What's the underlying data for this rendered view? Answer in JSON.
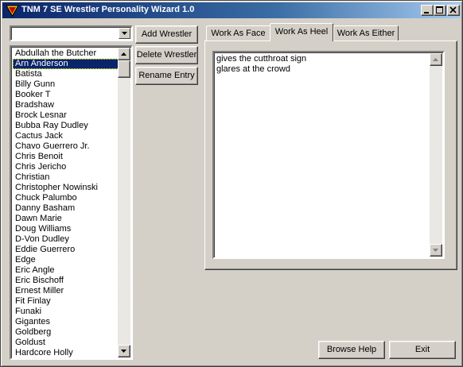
{
  "window": {
    "title": "TNM 7 SE Wrestler Personality Wizard 1.0"
  },
  "combo": {
    "value": ""
  },
  "wrestlers": [
    "Abdullah the Butcher",
    "Arn Anderson",
    "Batista",
    "Billy Gunn",
    "Booker T",
    "Bradshaw",
    "Brock Lesnar",
    "Bubba Ray Dudley",
    "Cactus Jack",
    "Chavo Guerrero Jr.",
    "Chris Benoit",
    "Chris Jericho",
    "Christian",
    "Christopher Nowinski",
    "Chuck Palumbo",
    "Danny Basham",
    "Dawn Marie",
    "Doug Williams",
    "D-Von Dudley",
    "Eddie Guerrero",
    "Edge",
    "Eric Angle",
    "Eric Bischoff",
    "Ernest Miller",
    "Fit Finlay",
    "Funaki",
    "Gigantes",
    "Goldberg",
    "Goldust",
    "Hardcore Holly"
  ],
  "selected_wrestler": "Arn Anderson",
  "buttons": {
    "add": "Add Wrestler",
    "delete": "Delete Wrestler",
    "rename": "Rename Entry",
    "browse_help": "Browse Help",
    "exit": "Exit"
  },
  "tabs": [
    {
      "label": "Work As Face",
      "active": false
    },
    {
      "label": "Work As Heel",
      "active": true
    },
    {
      "label": "Work As Either",
      "active": false
    }
  ],
  "memo_lines": [
    "gives the cutthroat sign",
    "glares at the crowd"
  ],
  "colors": {
    "face": "#d4d0c8",
    "selection": "#0a246a",
    "title_start": "#0a246a",
    "title_end": "#a6caf0"
  }
}
